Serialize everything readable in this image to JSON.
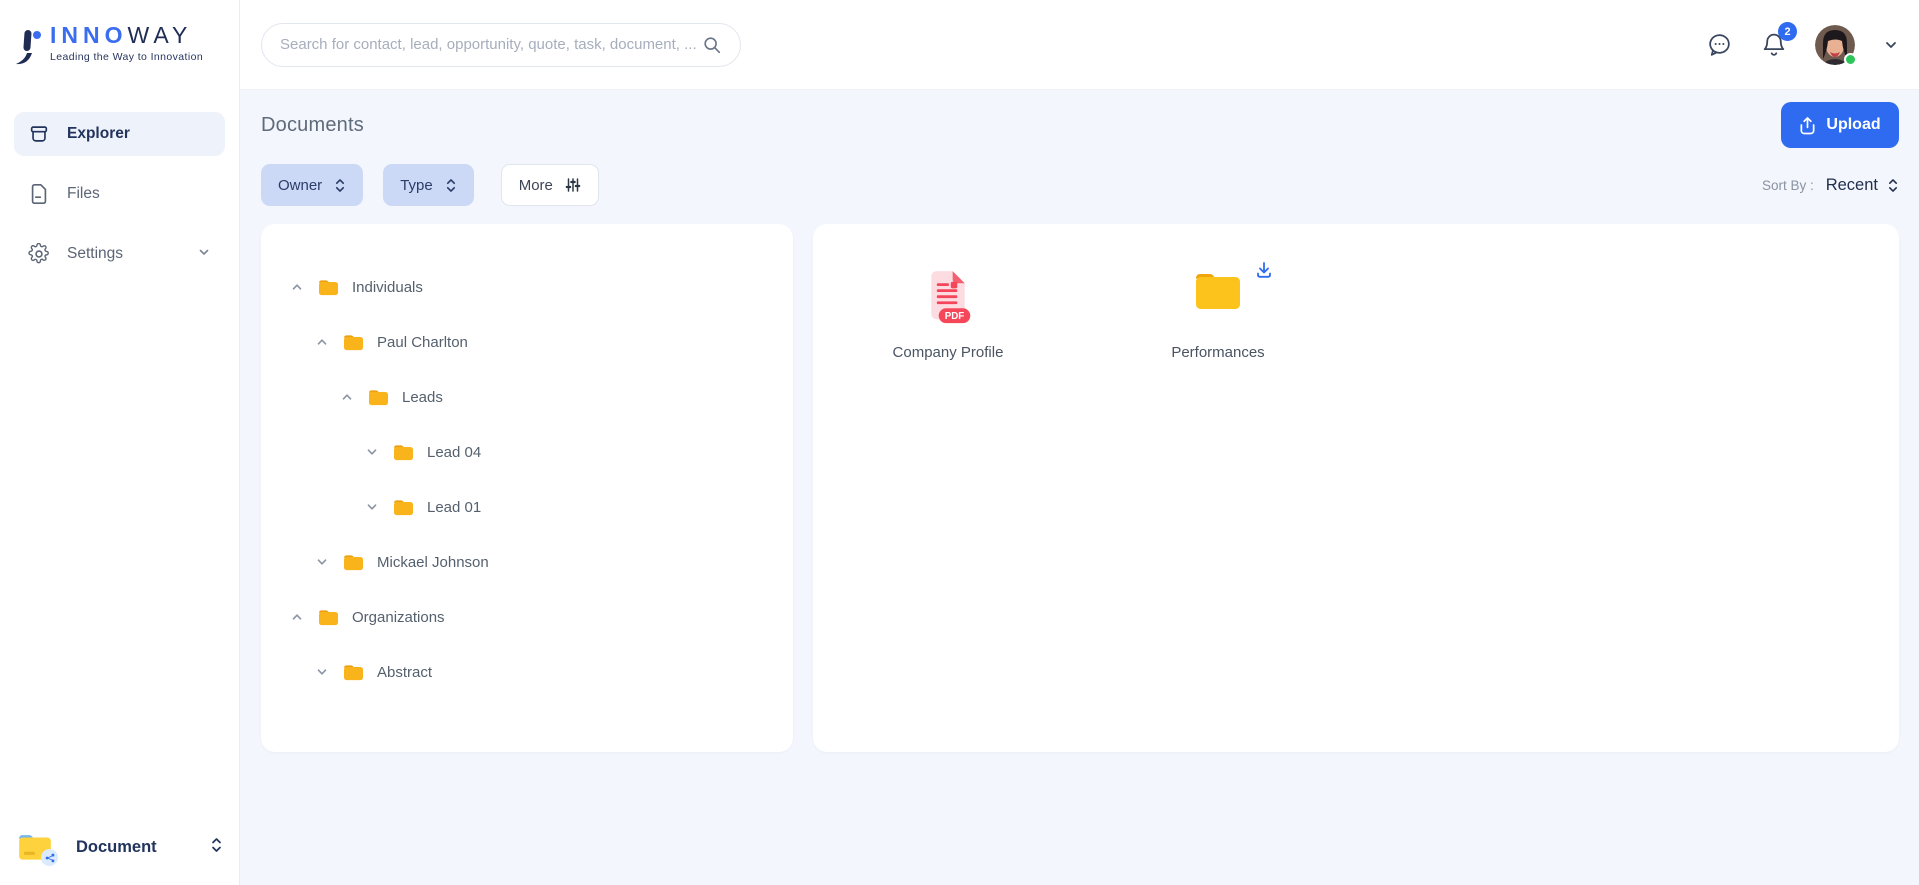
{
  "brand": {
    "name_primary": "INNO",
    "name_secondary": "WAY",
    "tagline": "Leading the Way to Innovation"
  },
  "sidebar": {
    "items": [
      {
        "label": "Explorer",
        "icon": "archive-icon",
        "active": true
      },
      {
        "label": "Files",
        "icon": "file-icon",
        "active": false
      },
      {
        "label": "Settings",
        "icon": "gear-icon",
        "active": false,
        "has_chevron": true
      }
    ],
    "footer": {
      "label": "Document",
      "icon": "folder-share-icon"
    }
  },
  "topbar": {
    "search_placeholder": "Search for contact, lead, opportunity, quote, task, document, ...",
    "notification_count": "2"
  },
  "page": {
    "title": "Documents",
    "upload_label": "Upload"
  },
  "filters": {
    "owner_label": "Owner",
    "type_label": "Type",
    "more_label": "More",
    "sort_by_label": "Sort By :",
    "sort_value": "Recent"
  },
  "tree": [
    {
      "label": "Individuals",
      "level": 0,
      "state": "expanded"
    },
    {
      "label": "Paul Charlton",
      "level": 1,
      "state": "expanded"
    },
    {
      "label": "Leads",
      "level": 2,
      "state": "expanded"
    },
    {
      "label": "Lead 04",
      "level": 3,
      "state": "collapsed"
    },
    {
      "label": "Lead 01",
      "level": 3,
      "state": "collapsed"
    },
    {
      "label": "Mickael Johnson",
      "level": 1,
      "state": "collapsed"
    },
    {
      "label": "Organizations",
      "level": 0,
      "state": "expanded"
    },
    {
      "label": "Abstract",
      "level": 1,
      "state": "collapsed"
    }
  ],
  "files": [
    {
      "label": "Company Profile",
      "type": "pdf",
      "has_download": false
    },
    {
      "label": "Performances",
      "type": "folder",
      "has_download": true
    }
  ],
  "colors": {
    "accent_blue": "#2e6bf0",
    "brand_blue": "#3a6df0",
    "brand_navy": "#1f2c54",
    "pill_bg": "#cbd9f7",
    "folder_yellow": "#fcc31d",
    "folder_tab": "#f0a50e",
    "pdf_red": "#f6475a",
    "pdf_page_pink": "#fcdce1",
    "status_green": "#2bc558",
    "content_bg": "#f3f6fc"
  }
}
